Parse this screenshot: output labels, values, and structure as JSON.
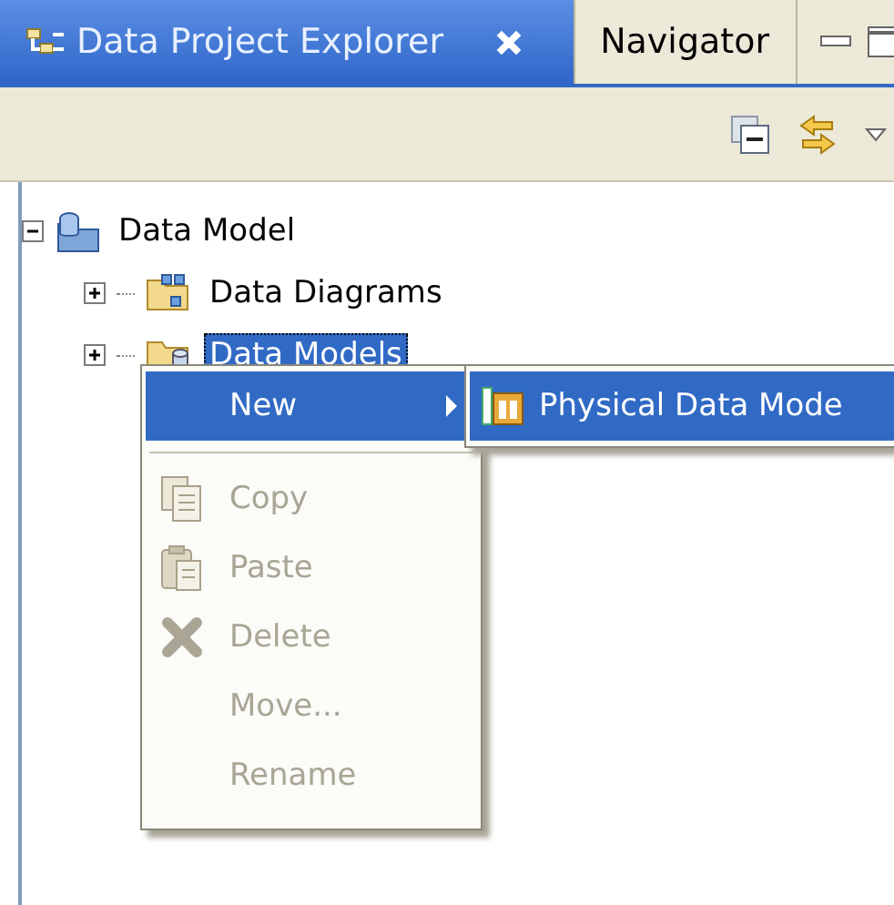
{
  "tabs": [
    {
      "label": "Data Project Explorer",
      "selected": true,
      "closable": true
    },
    {
      "label": "Navigator",
      "selected": false,
      "closable": false
    }
  ],
  "tree": [
    {
      "label": "Data Model",
      "expanded": true,
      "selected": false,
      "children": [
        {
          "label": "Data Diagrams",
          "expanded": false,
          "selected": false
        },
        {
          "label": "Data Models",
          "expanded": false,
          "selected": true
        }
      ]
    }
  ],
  "context_menu": {
    "items": [
      {
        "kind": "item",
        "label": "New",
        "selected": true,
        "disabled": false,
        "submenu": true
      },
      {
        "kind": "separator"
      },
      {
        "kind": "item",
        "label": "Copy",
        "selected": false,
        "disabled": true,
        "submenu": false
      },
      {
        "kind": "item",
        "label": "Paste",
        "selected": false,
        "disabled": true,
        "submenu": false
      },
      {
        "kind": "item",
        "label": "Delete",
        "selected": false,
        "disabled": true,
        "submenu": false
      },
      {
        "kind": "item",
        "label": "Move...",
        "selected": false,
        "disabled": true,
        "submenu": false
      },
      {
        "kind": "item",
        "label": "Rename",
        "selected": false,
        "disabled": true,
        "submenu": false
      }
    ]
  },
  "submenu": {
    "items": [
      {
        "label": "Physical Data Mode",
        "selected": true
      }
    ]
  }
}
